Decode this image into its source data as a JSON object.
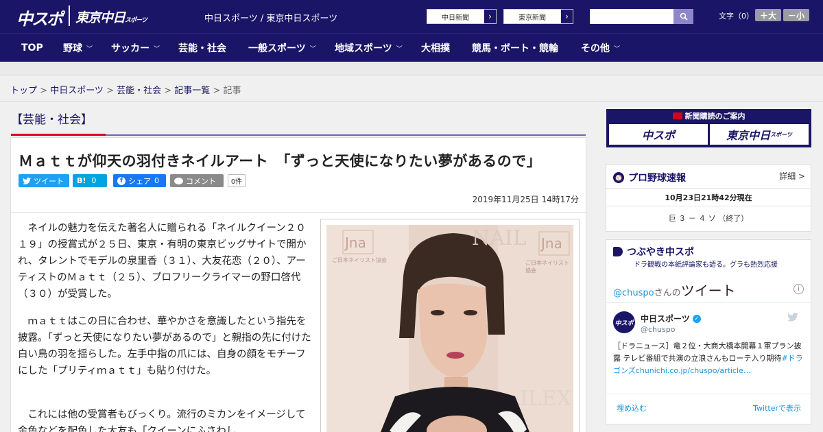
{
  "header": {
    "logo_chuspo": "中スポ",
    "logo_tokyo": "東京中日",
    "logo_tokyo_small": "スポーツ",
    "site_title": "中日スポーツ / 東京中日スポーツ",
    "paper_links": [
      "中日新聞",
      "東京新聞"
    ],
    "search_placeholder": "",
    "font_size_label": "文字（0）",
    "font_bigger": "＋大",
    "font_smaller": "－小"
  },
  "nav": [
    {
      "label": "TOP",
      "dropdown": false
    },
    {
      "label": "野球",
      "dropdown": true
    },
    {
      "label": "サッカー",
      "dropdown": true
    },
    {
      "label": "芸能・社会",
      "dropdown": false
    },
    {
      "label": "一般スポーツ",
      "dropdown": true
    },
    {
      "label": "地域スポーツ",
      "dropdown": true
    },
    {
      "label": "大相撲",
      "dropdown": false
    },
    {
      "label": "競馬・ボート・競輪",
      "dropdown": false
    },
    {
      "label": "その他",
      "dropdown": true
    }
  ],
  "breadcrumb": {
    "items": [
      "トップ",
      "中日スポーツ",
      "芸能・社会",
      "記事一覧"
    ],
    "current": "記事",
    "sep": " > "
  },
  "category": "【芸能・社会】",
  "article": {
    "headline": "Ｍａｔｔが仰天の羽付きネイルアート　「ずっと天使になりたい夢があるので」",
    "share": {
      "tweet": "ツイート",
      "hatena": "B!",
      "hatena_count": "0",
      "facebook": "シェア",
      "facebook_count": "0",
      "comment": "コメント",
      "comment_count": "0件"
    },
    "date": "2019年11月25日 14時17分",
    "paragraphs": [
      "ネイルの魅力を伝えた著名人に贈られる「ネイルクイーン２０１９」の授賞式が２５日、東京・有明の東京ビッグサイトで開かれ、タレントでモデルの泉里香（３１）、大友花恋（２０）、アーティストのＭａｔｔ（２５）、プロフリークライマーの野口啓代（３０）が受賞した。",
      "ｍａｔｔはこの日に合わせ、華やかさを意識したという指先を披露。「ずっと天使になりたい夢があるので」と親指の先に付けた白い鳥の羽を揺らした。左手中指の爪には、自身の顔をモチーフにした「プリティｍａｔｔ」も貼り付けた。",
      "これには他の受賞者もびっくり。流行のミカンをイメージして金色などを配色した大友も「クイーンにふさわし"
    ],
    "photo_text": {
      "jna1": "Jna",
      "jna2": "Jna",
      "assoc": "ご日本ネイリスト協会",
      "assoc2": "ご日本ネイリスト協会",
      "nail": "NAIL",
      "expo": "ILEXP"
    }
  },
  "sidebar": {
    "subscribe": {
      "title": "新聞購読のご案内",
      "btn1": "中スポ",
      "btn2": "東京中日",
      "btn2_small": "スポーツ"
    },
    "baseball": {
      "title": "プロ野球速報",
      "more": "詳細 >",
      "time": "10月23日21時42分現在",
      "score": "巨 ３ － ４ ソ （終了）"
    },
    "tweets": {
      "title": "つぶやき中スポ",
      "subtitle": "ドラ観戦の本紙評論家も語る。グラも熱烈応援",
      "handle": "@chuspo",
      "handle_suffix": "さんの",
      "tweet_word": "ツイート",
      "avatar_text": "中スポ",
      "user_name": "中日スポーツ",
      "user_handle": "@chuspo",
      "text": "［ドラニュース］竜２位・大商大橋本開幕１軍プラン披露 テレビ番組で共演の立浪さんもローテ入り期待",
      "hashtag": "#ドラゴンズ",
      "link": "chunichi.co.jp/chuspo/article…",
      "embed": "埋め込む",
      "view_on": "Twitterで表示"
    }
  },
  "colors": {
    "brand_navy": "#1a1566",
    "accent_red": "#d6001c",
    "twitter": "#1da1f2",
    "hatena": "#00a4de",
    "facebook": "#1877f2"
  }
}
